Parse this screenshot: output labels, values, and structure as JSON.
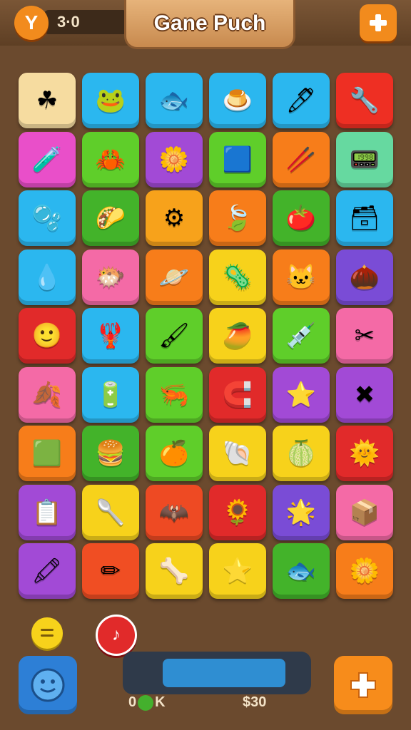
{
  "header": {
    "title": "Gane Puch",
    "score": "3·0",
    "left_icon": "y-badge-icon",
    "right_icon": "plus-icon"
  },
  "board": {
    "rows": [
      [
        {
          "color": "#f6dca0",
          "icon": "☘"
        },
        {
          "color": "#2bb7ef",
          "icon": "🐸"
        },
        {
          "color": "#2bb7ef",
          "icon": "🐟"
        },
        {
          "color": "#2bb7ef",
          "icon": "🍮"
        },
        {
          "color": "#2bb7ef",
          "icon": "🖊"
        },
        {
          "color": "#ee2f23",
          "icon": "🔧"
        }
      ],
      [
        {
          "color": "#e94fc9",
          "icon": "🧪"
        },
        {
          "color": "#5fce2a",
          "icon": "🦀"
        },
        {
          "color": "#a24ad6",
          "icon": "🌼"
        },
        {
          "color": "#5fce2a",
          "icon": "🟦"
        },
        {
          "color": "#f77d1a",
          "icon": "🥢"
        },
        {
          "color": "#66d9a0",
          "icon": "📟"
        }
      ],
      [
        {
          "color": "#2bb7ef",
          "icon": "🫧"
        },
        {
          "color": "#43b32a",
          "icon": "🌮"
        },
        {
          "color": "#f7a21b",
          "icon": "⚙"
        },
        {
          "color": "#f77d1a",
          "icon": "🍃"
        },
        {
          "color": "#43b32a",
          "icon": "🍅"
        },
        {
          "color": "#2bb7ef",
          "icon": "🗃"
        }
      ],
      [
        {
          "color": "#2bb7ef",
          "icon": "💧"
        },
        {
          "color": "#f46aa6",
          "icon": "🐡"
        },
        {
          "color": "#f77d1a",
          "icon": "🪐"
        },
        {
          "color": "#f7d21b",
          "icon": "🦠"
        },
        {
          "color": "#f77d1a",
          "icon": "🐱"
        },
        {
          "color": "#7a4cd6",
          "icon": "🌰"
        }
      ],
      [
        {
          "color": "#e12a2a",
          "icon": "🙂"
        },
        {
          "color": "#2bb7ef",
          "icon": "🦞"
        },
        {
          "color": "#5fce2a",
          "icon": "🖌"
        },
        {
          "color": "#f7d21b",
          "icon": "🥭"
        },
        {
          "color": "#5fce2a",
          "icon": "💉"
        },
        {
          "color": "#f46aa6",
          "icon": "✂"
        }
      ],
      [
        {
          "color": "#f46aa6",
          "icon": "🍂"
        },
        {
          "color": "#2bb7ef",
          "icon": "🔋"
        },
        {
          "color": "#5fce2a",
          "icon": "🦐"
        },
        {
          "color": "#e12a2a",
          "icon": "🧲"
        },
        {
          "color": "#a24ad6",
          "icon": "⭐"
        },
        {
          "color": "#a24ad6",
          "icon": "✖"
        }
      ],
      [
        {
          "color": "#f77d1a",
          "icon": "🟩"
        },
        {
          "color": "#43b32a",
          "icon": "🍔"
        },
        {
          "color": "#5fce2a",
          "icon": "🍊"
        },
        {
          "color": "#f7d21b",
          "icon": "🐚"
        },
        {
          "color": "#f7d21b",
          "icon": "🍈"
        },
        {
          "color": "#e12a2a",
          "icon": "🌞"
        }
      ],
      [
        {
          "color": "#a24ad6",
          "icon": "📋"
        },
        {
          "color": "#f7d21b",
          "icon": "🥄"
        },
        {
          "color": "#ee4a23",
          "icon": "🦇"
        },
        {
          "color": "#e12a2a",
          "icon": "🌻"
        },
        {
          "color": "#7a4cd6",
          "icon": "🌟"
        },
        {
          "color": "#f46aa6",
          "icon": "📦"
        }
      ],
      [
        {
          "color": "#a24ad6",
          "icon": "🖍"
        },
        {
          "color": "#f04e23",
          "icon": "✏"
        },
        {
          "color": "#f7d21b",
          "icon": "🦴"
        },
        {
          "color": "#f7d21b",
          "icon": "⭐"
        },
        {
          "color": "#43b32a",
          "icon": "🐟"
        },
        {
          "color": "#f77d1a",
          "icon": "🌼"
        }
      ]
    ]
  },
  "footer": {
    "left_label_prefix": "0",
    "left_label_suffix": "K",
    "right_label": "$30",
    "progress_fraction": 0.65,
    "left_button_icon": "smiley-icon",
    "right_button_icon": "plus-icon",
    "small_yellow_icon": "equals-icon",
    "small_red_icon": "music-note-icon"
  }
}
